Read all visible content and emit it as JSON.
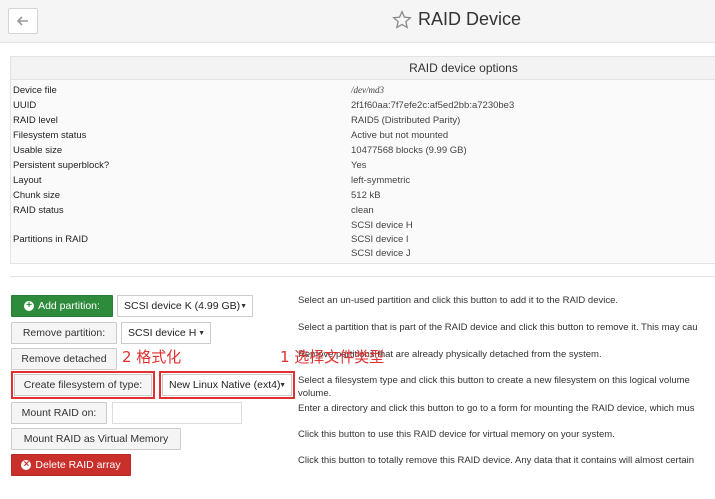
{
  "header": {
    "title": "RAID Device",
    "back_label": "←"
  },
  "options": {
    "title": "RAID device options",
    "rows": [
      {
        "label": "Device file",
        "value": "/dev/md3"
      },
      {
        "label": "UUID",
        "value": "2f1f60aa:7f7efe2c:af5ed2bb:a7230be3"
      },
      {
        "label": "RAID level",
        "value": "RAID5 (Distributed Parity)"
      },
      {
        "label": "Filesystem status",
        "value": "Active but not mounted"
      },
      {
        "label": "Usable size",
        "value": "10477568 blocks (9.99 GB)"
      },
      {
        "label": "Persistent superblock?",
        "value": "Yes"
      },
      {
        "label": "Layout",
        "value": "left-symmetric"
      },
      {
        "label": "Chunk size",
        "value": "512 kB"
      },
      {
        "label": "RAID status",
        "value": "clean"
      }
    ],
    "partitions_label": "Partitions in RAID",
    "partitions": [
      "SCSI device H",
      "SCSI device I",
      "SCSI device J"
    ]
  },
  "actions": {
    "add_partition": {
      "label": "Add partition:",
      "select": "SCSI device K (4.99 GB)",
      "desc": "Select an un-used partition and click this button to add it to the RAID device."
    },
    "remove_partition": {
      "label": "Remove partition:",
      "select": "SCSI device H",
      "desc": "Select a partition that is part of the RAID device and click this button to remove it. This may cau"
    },
    "remove_detached": {
      "label": "Remove detached",
      "desc": "Remove partitions that are already physically detached from the system."
    },
    "create_fs": {
      "label": "Create filesystem of type:",
      "select": "New Linux Native (ext4)",
      "desc": "Select a filesystem type and click this button to create a new filesystem on this logical volume",
      "desc2": "volume."
    },
    "mount": {
      "label": "Mount RAID on:",
      "desc": "Enter a directory and click this button to go to a form for mounting the RAID device, which mus"
    },
    "virtual_memory": {
      "label": "Mount RAID as Virtual Memory",
      "desc": "Click this button to use this RAID device for virtual memory on your system."
    },
    "delete": {
      "label": "Delete RAID array",
      "desc": "Click this button to totally remove this RAID device. Any data that it contains will almost certain"
    }
  },
  "annotations": {
    "a1": "1 选择文件类型",
    "a2": "2 格式化"
  },
  "colors": {
    "green": "#2e8b3c",
    "red": "#c9302c",
    "highlight": "#e03030"
  }
}
